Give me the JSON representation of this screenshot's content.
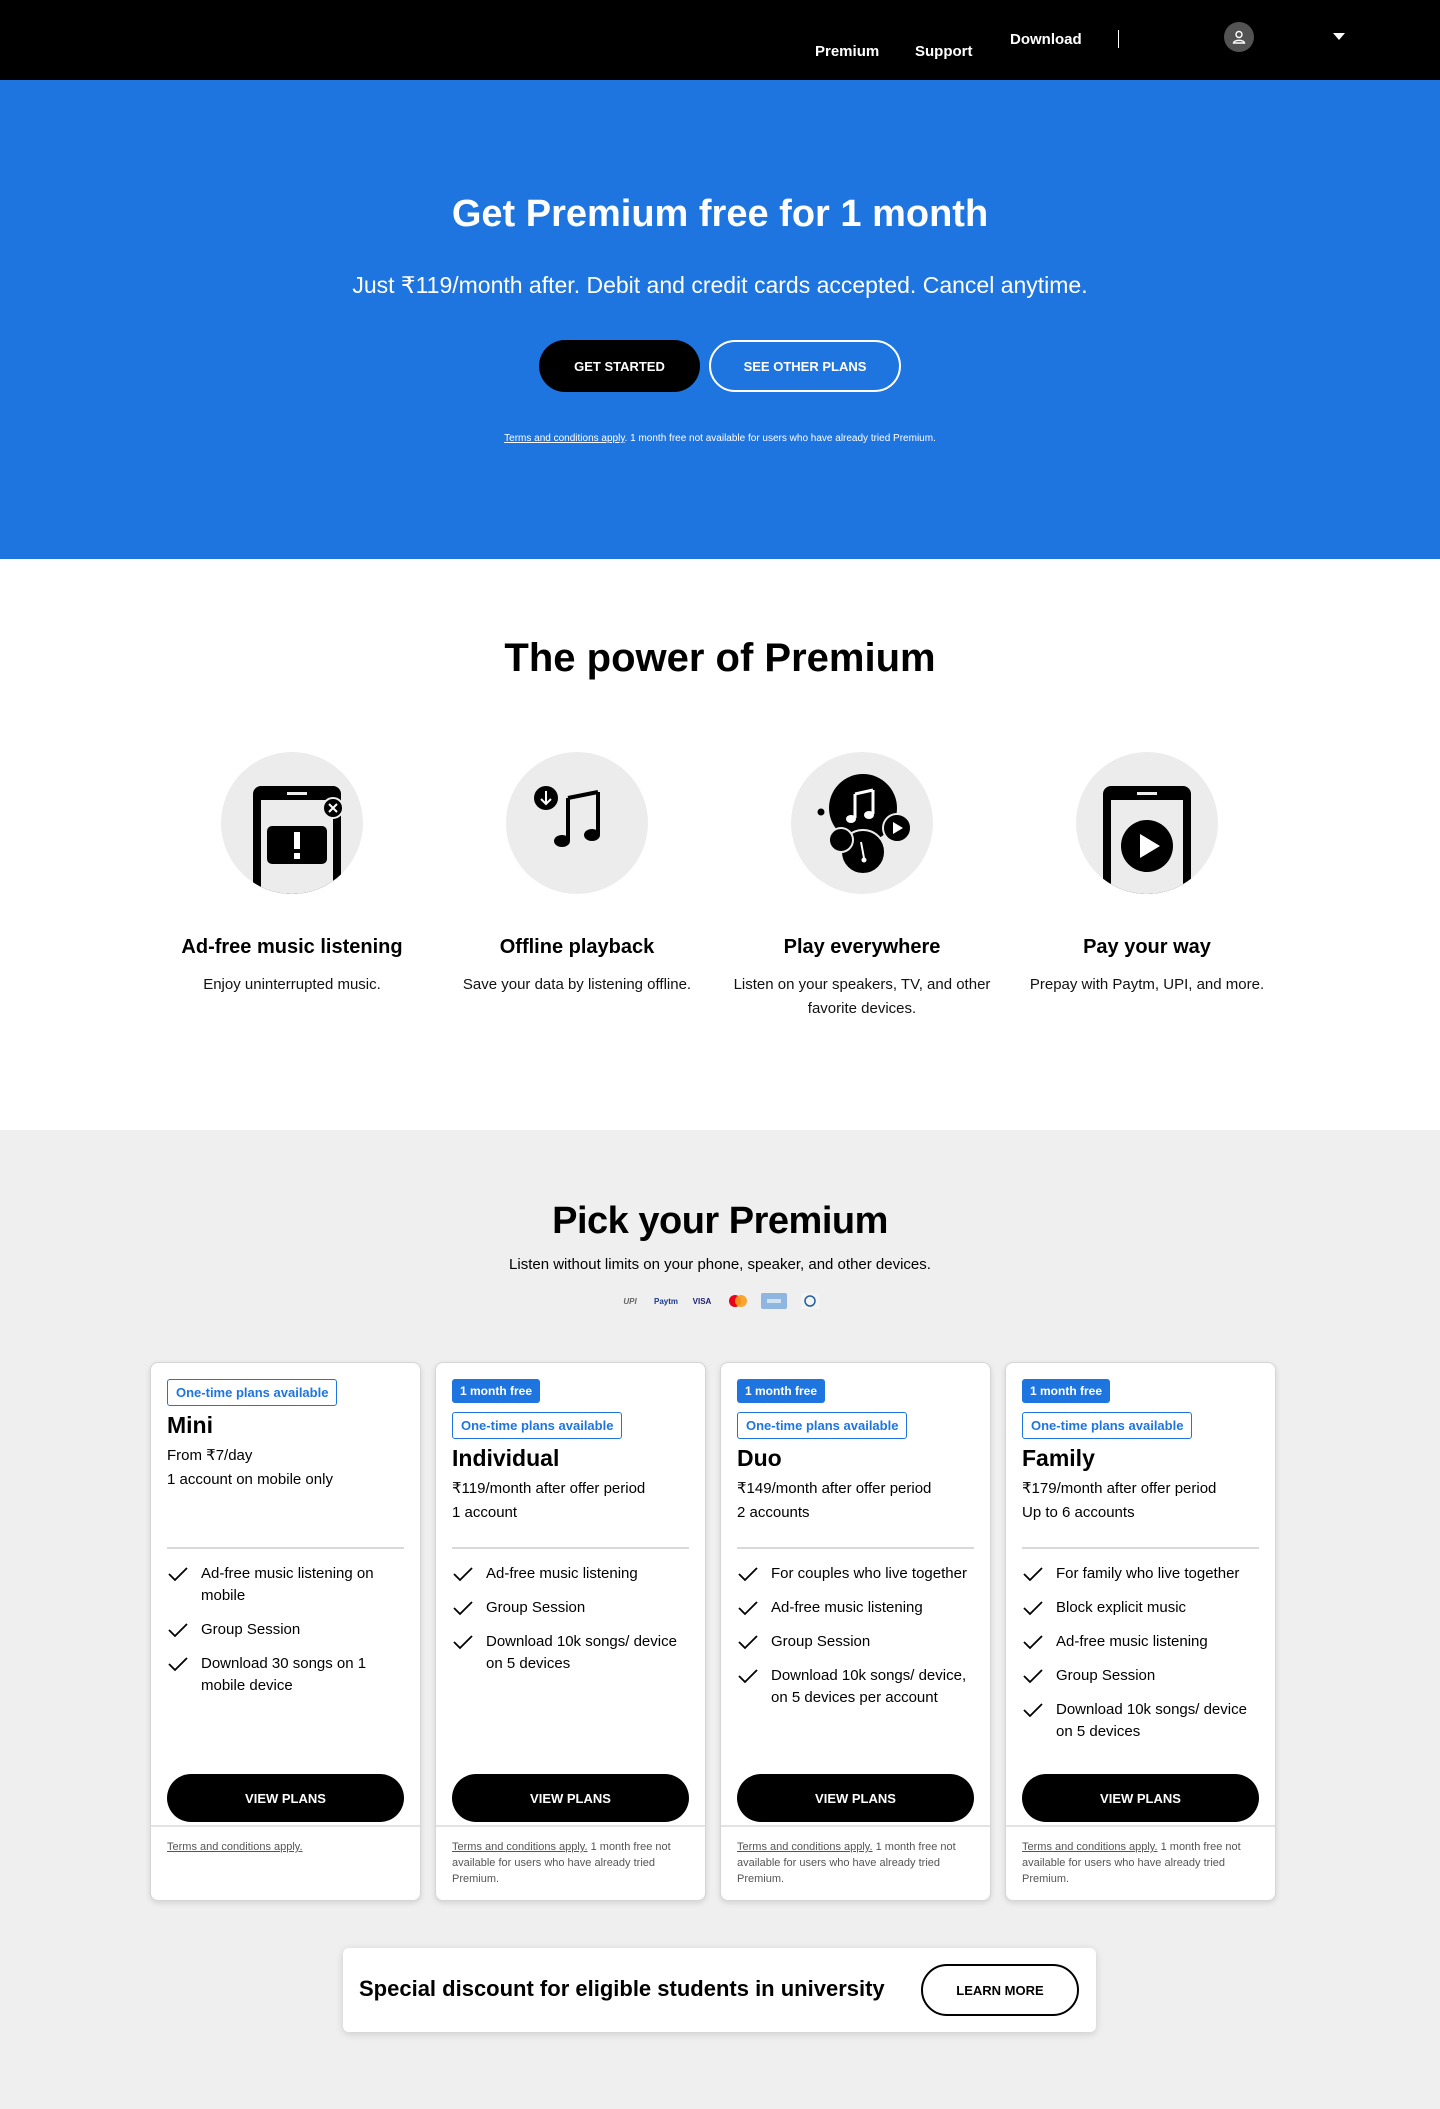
{
  "nav": {
    "premium": "Premium",
    "support": "Support",
    "download": "Download"
  },
  "hero": {
    "title": "Get Premium free for 1 month",
    "subtitle": "Just ₹119/month after. Debit and credit cards accepted. Cancel anytime.",
    "get_started": "GET STARTED",
    "see_other_plans": "SEE OTHER PLANS",
    "terms_link": "Terms and conditions apply",
    "terms_rest": ". 1 month free not available for users who have already tried Premium."
  },
  "power": {
    "title": "The power of Premium",
    "features": [
      {
        "title": "Ad-free music listening",
        "desc": "Enjoy uninterrupted music.",
        "icon": "no-ads-phone-icon"
      },
      {
        "title": "Offline playback",
        "desc": "Save your data by listening offline.",
        "icon": "download-music-icon"
      },
      {
        "title": "Play everywhere",
        "desc": "Listen on your speakers, TV, and other favorite devices.",
        "icon": "devices-icon"
      },
      {
        "title": "Pay your way",
        "desc": "Prepay with Paytm, UPI, and more.",
        "icon": "phone-play-icon"
      }
    ]
  },
  "pick": {
    "title": "Pick your Premium",
    "subtitle": "Listen without limits on your phone, speaker, and other devices.",
    "payments": [
      "UPI",
      "Paytm",
      "VISA",
      "mastercard",
      "AMEX",
      "Diners"
    ],
    "plans": [
      {
        "free_badge": "",
        "onetime_badge": "One-time plans available",
        "name": "Mini",
        "price": "From ₹7/day",
        "accounts": "1 account on mobile only",
        "features": [
          "Ad-free music listening on mobile",
          "Group Session",
          "Download 30 songs on 1 mobile device"
        ],
        "button": "VIEW PLANS",
        "terms_link": "Terms and conditions apply.",
        "terms_rest": ""
      },
      {
        "free_badge": "1 month free",
        "onetime_badge": "One-time plans available",
        "name": "Individual",
        "price": "₹119/month after offer period",
        "accounts": "1 account",
        "features": [
          "Ad-free music listening",
          "Group Session",
          "Download 10k songs/ device on 5 devices"
        ],
        "button": "VIEW PLANS",
        "terms_link": "Terms and conditions apply.",
        "terms_rest": " 1 month free not available for users who have already tried Premium."
      },
      {
        "free_badge": "1 month free",
        "onetime_badge": "One-time plans available",
        "name": "Duo",
        "price": "₹149/month after offer period",
        "accounts": "2 accounts",
        "features": [
          "For couples who live together",
          "Ad-free music listening",
          "Group Session",
          "Download 10k songs/ device, on 5 devices per account"
        ],
        "button": "VIEW PLANS",
        "terms_link": "Terms and conditions apply.",
        "terms_rest": " 1 month free not available for users who have already tried Premium."
      },
      {
        "free_badge": "1 month free",
        "onetime_badge": "One-time plans available",
        "name": "Family",
        "price": "₹179/month after offer period",
        "accounts": "Up to 6 accounts",
        "features": [
          "For family who live together",
          "Block explicit music",
          "Ad-free music listening",
          "Group Session",
          "Download 10k songs/ device on 5 devices"
        ],
        "button": "VIEW PLANS",
        "terms_link": "Terms and conditions apply.",
        "terms_rest": " 1 month free not available for users who have already tried Premium."
      }
    ],
    "student": {
      "text": "Special discount for eligible students in university",
      "button": "LEARN MORE"
    }
  },
  "colors": {
    "brand_blue": "#1e75e0",
    "nav_bg": "#000000",
    "section_gray": "#efefef"
  }
}
